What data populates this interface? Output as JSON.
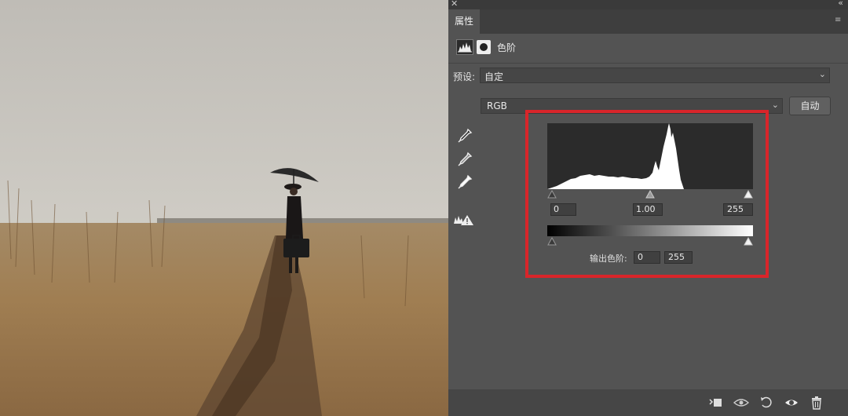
{
  "panel": {
    "tab_label": "属性",
    "adjustment_title": "色阶",
    "preset_label": "预设:",
    "preset_value": "自定",
    "channel_value": "RGB",
    "auto_button_label": "自动",
    "input_black": "0",
    "input_gamma": "1.00",
    "input_white": "255",
    "output_label": "输出色阶:",
    "output_black": "0",
    "output_white": "255"
  },
  "colors": {
    "panel_bg": "#535353",
    "highlight_border": "#d9252a"
  }
}
